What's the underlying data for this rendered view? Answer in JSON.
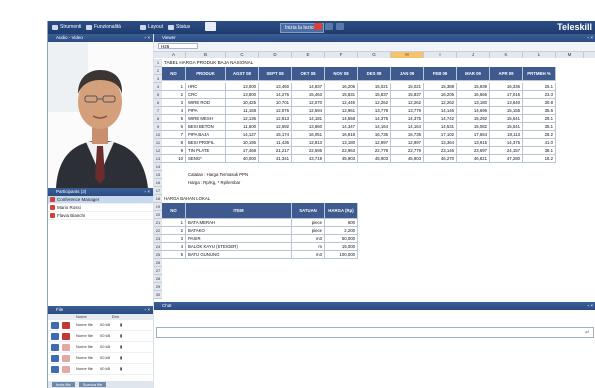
{
  "topbar": {
    "items": [
      "Strumenti",
      "Funzionalità",
      "Layout",
      "Status"
    ],
    "center_button": "Inizia la lezione",
    "brand": "Teleskill"
  },
  "panels": {
    "audio_video": "Audio - Video",
    "participants": "Participants (3)",
    "files": "File",
    "chat": "Chat",
    "sheet_title": "Viewer"
  },
  "participants": [
    "Conference Manager",
    "Mario Rossi",
    "Flavia Bianchi"
  ],
  "files": {
    "headers": [
      "Nome",
      "Dim"
    ],
    "rows": [
      {
        "name": "Nome file",
        "size": "00 kB"
      },
      {
        "name": "Nome file",
        "size": "00 kB"
      },
      {
        "name": "Nome file",
        "size": "00 kB"
      },
      {
        "name": "Nome file",
        "size": "00 kB"
      },
      {
        "name": "Nome file",
        "size": "00 kB"
      }
    ],
    "buttons": [
      "Invia file",
      "Scarica file"
    ]
  },
  "sheet": {
    "cell_ref": "H26",
    "columns": [
      "A",
      "B",
      "C",
      "D",
      "E",
      "F",
      "G",
      "H",
      "I",
      "J",
      "K",
      "L",
      "M"
    ],
    "title": "TABEL HARGA PRODUK BAJA NASIONAL",
    "headers": [
      "NO",
      "PRODUK",
      "AGST 08",
      "SEPT 08",
      "OKT 08",
      "NOV 08",
      "DES 08",
      "JAN 09",
      "FEB 09",
      "MAR 09",
      "APR 09",
      "PRTMBH %"
    ],
    "rows": [
      [
        "1",
        "HRC",
        "13,000",
        "13,460",
        "14,837",
        "16,206",
        "15,021",
        "15,021",
        "15,388",
        "15,939",
        "16,336",
        "25.1"
      ],
      [
        "2",
        "CRC",
        "13,800",
        "14,276",
        "15,463",
        "15,831",
        "15,837",
        "15,837",
        "16,205",
        "16,566",
        "17,016",
        "23.3"
      ],
      [
        "3",
        "WIRE ROD",
        "10,425",
        "10,701",
        "12,070",
        "12,446",
        "12,262",
        "12,262",
        "12,262",
        "13,180",
        "13,640",
        "30.8"
      ],
      [
        "4",
        "PIPA",
        "11,168",
        "12,076",
        "12,594",
        "12,961",
        "13,779",
        "13,779",
        "14,146",
        "14,696",
        "15,155",
        "35.6"
      ],
      [
        "5",
        "WIRE MESH",
        "12,136",
        "12,813",
        "14,181",
        "14,558",
        "14,375",
        "14,375",
        "14,742",
        "15,292",
        "15,641",
        "29.1"
      ],
      [
        "6",
        "BESI BETON",
        "11,600",
        "12,692",
        "13,860",
        "14,347",
        "14,164",
        "14,164",
        "14,531",
        "15,082",
        "15,541",
        "35.1"
      ],
      [
        "7",
        "PIPA BAJA",
        "14,127",
        "15,174",
        "16,051",
        "16,918",
        "16,735",
        "16,735",
        "17,102",
        "17,654",
        "18,113",
        "28.2"
      ],
      [
        "8",
        "BESI PROFIL",
        "10,195",
        "11,436",
        "12,813",
        "13,180",
        "12,997",
        "12,997",
        "13,364",
        "13,915",
        "14,375",
        "41.0"
      ],
      [
        "9",
        "TIN PLATE",
        "17,468",
        "21,217",
        "22,595",
        "22,963",
        "22,779",
        "22,779",
        "23,146",
        "23,697",
        "24,157",
        "38.1"
      ],
      [
        "10",
        "SENG*",
        "40,000",
        "41,341",
        "43,719",
        "45,903",
        "45,903",
        "45,903",
        "46,270",
        "46,821",
        "47,280",
        "18.2"
      ]
    ],
    "notes": [
      "Catatan : Harga Termasuk PPN",
      "Harga : Rp/Kg, * Rp/lembar"
    ],
    "local_title": "HARGA BAHAN LOKAL",
    "local_headers": [
      "NO",
      "ITEM",
      "SATUAN",
      "HARGA (Rp)"
    ],
    "local_rows": [
      [
        "1",
        "BATA MERAH",
        "piece",
        "600"
      ],
      [
        "2",
        "BATAKO",
        "piece",
        "2,200"
      ],
      [
        "3",
        "PASIR",
        "m3",
        "50,000"
      ],
      [
        "4",
        "BALOK KAYU (STEIGER)",
        "m",
        "15,000"
      ],
      [
        "5",
        "BATU GUNUNG",
        "m3",
        "100,000"
      ]
    ]
  }
}
